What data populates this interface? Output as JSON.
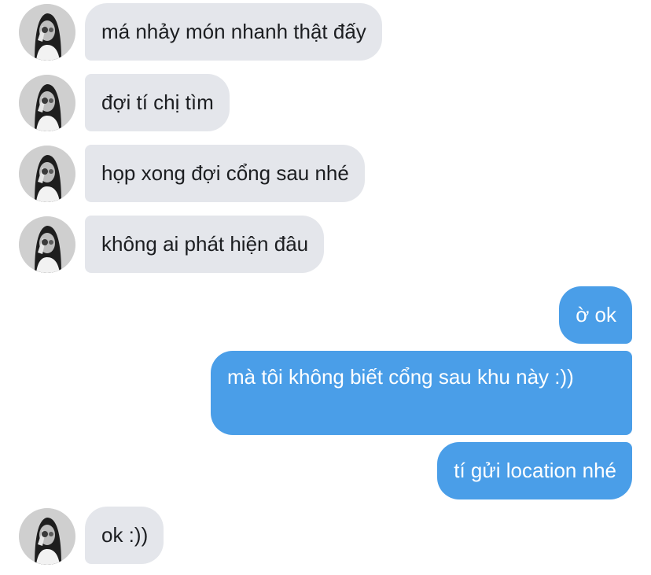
{
  "colors": {
    "incoming_bubble": "#e4e6eb",
    "outgoing_bubble": "#4a9ee8",
    "outgoing_text": "#ffffff",
    "incoming_text": "#1c1e21"
  },
  "messages": [
    {
      "sender": "contact",
      "text": "má nhảy món nhanh thật đấy",
      "avatar_icon": "contact-avatar"
    },
    {
      "sender": "contact",
      "text": "đợi tí chị tìm",
      "avatar_icon": "contact-avatar"
    },
    {
      "sender": "contact",
      "text": "họp xong đợi cổng sau nhé",
      "avatar_icon": "contact-avatar"
    },
    {
      "sender": "contact",
      "text": "không ai phát hiện đâu",
      "avatar_icon": "contact-avatar"
    },
    {
      "sender": "me",
      "text": "ờ ok"
    },
    {
      "sender": "me",
      "text": "mà tôi không biết cổng sau khu này :))"
    },
    {
      "sender": "me",
      "text": "tí gửi location nhé"
    },
    {
      "sender": "contact",
      "text": "ok :))",
      "avatar_icon": "contact-avatar"
    }
  ]
}
